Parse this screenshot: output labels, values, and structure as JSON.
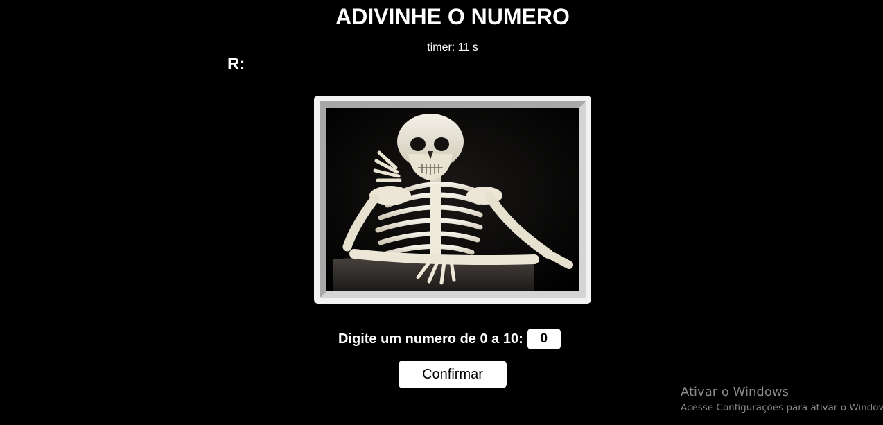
{
  "header": {
    "title": "ADIVINHE O NUMERO",
    "timer": "timer: 11 s"
  },
  "answer": {
    "label": "R:"
  },
  "image": {
    "icon": "skeleton-waiting-image",
    "frame_light_color": "#f2f2f2",
    "frame_gray_color": "#a8a8a8"
  },
  "form": {
    "prompt": "Digite um numero de 0 a 10:",
    "input_value": "0",
    "confirm_label": "Confirmar"
  },
  "watermark": {
    "title": "Ativar o Windows",
    "subtitle": "Acesse Configurações para ativar o Windows."
  },
  "colors": {
    "background": "#000000",
    "text": "#ffffff",
    "watermark": "#8a8a8a"
  }
}
